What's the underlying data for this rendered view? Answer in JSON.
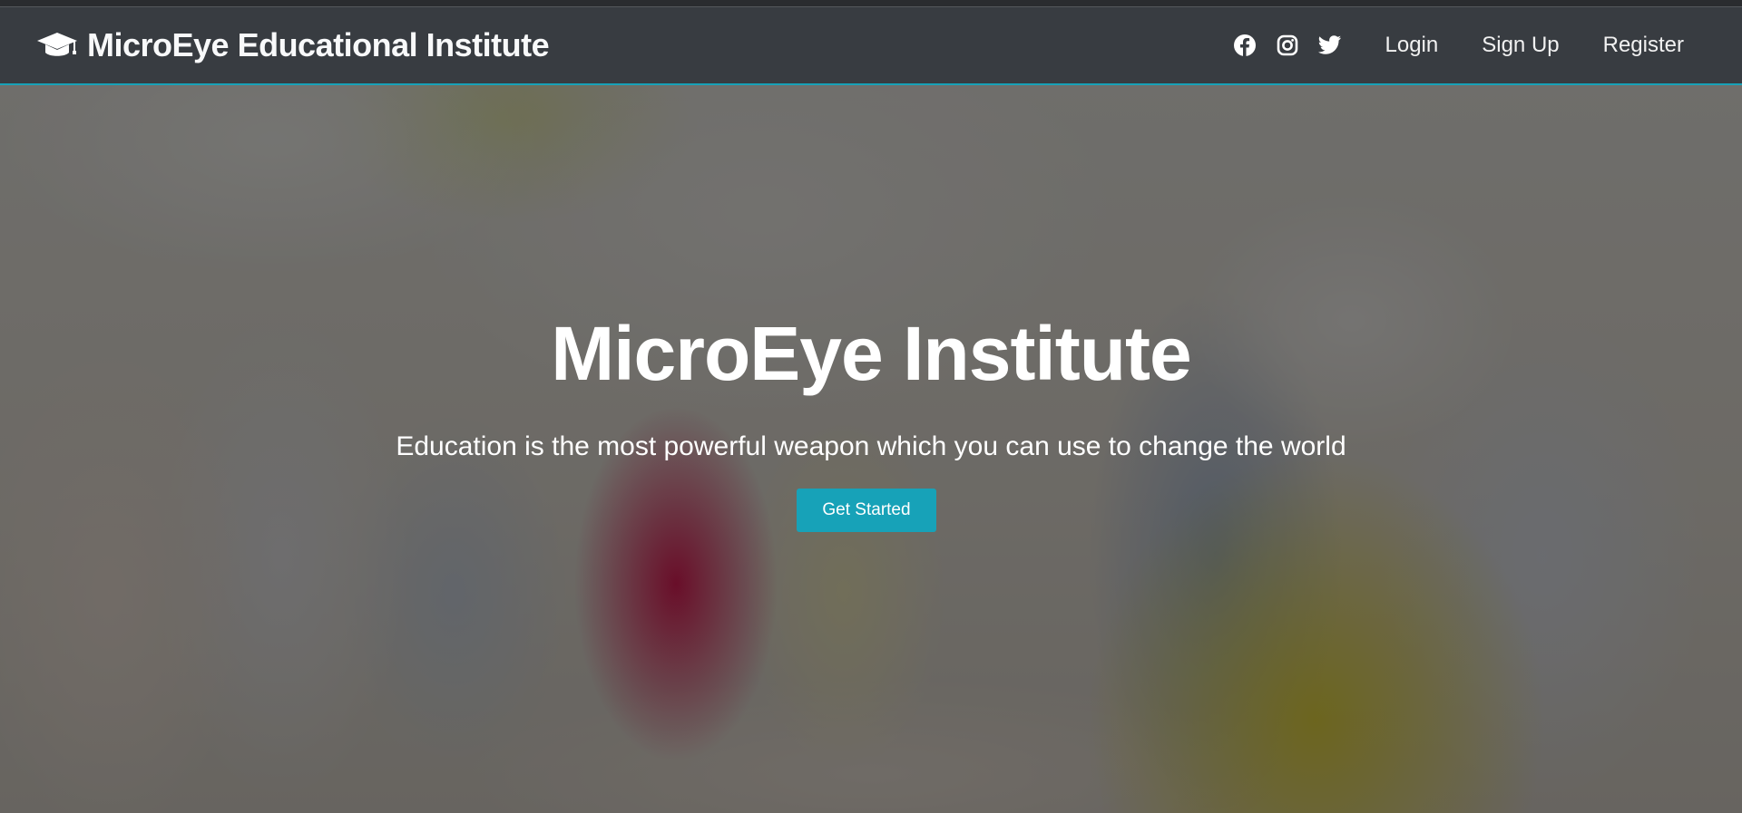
{
  "navbar": {
    "brand": {
      "icon": "graduation-cap-icon",
      "title": "MicroEye Educational Institute"
    },
    "social": [
      {
        "name": "facebook-icon"
      },
      {
        "name": "instagram-icon"
      },
      {
        "name": "twitter-icon"
      }
    ],
    "links": {
      "login": "Login",
      "signup": "Sign Up",
      "register": "Register"
    },
    "accent_color": "#17a2b8"
  },
  "hero": {
    "title": "MicroEye Institute",
    "subtitle": "Education is the most powerful weapon which you can use to change the world",
    "button_label": "Get Started",
    "button_color": "#17a2b8"
  }
}
